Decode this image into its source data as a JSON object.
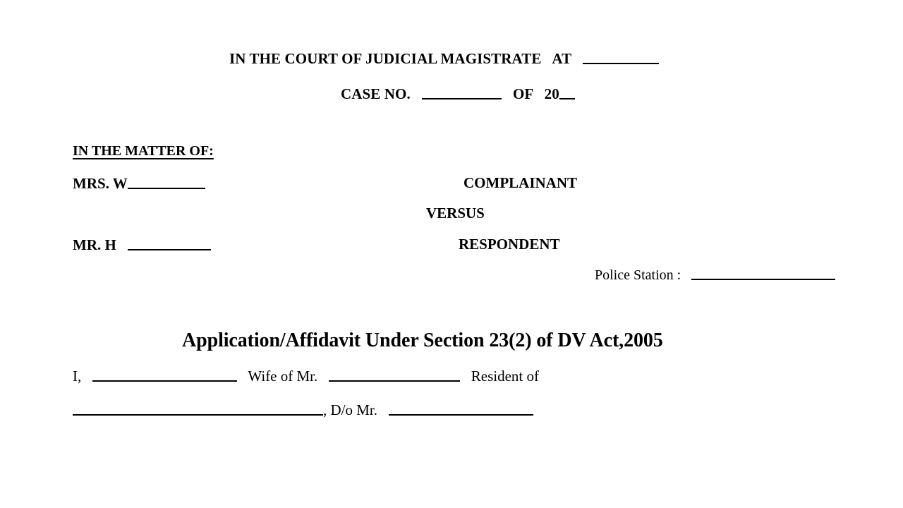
{
  "document": {
    "heading": {
      "court_line_prefix": "IN THE COURT OF JUDICIAL MAGISTRATE",
      "court_line_at": "AT",
      "case_no_label": "CASE NO.",
      "case_no_of": "OF",
      "case_year_prefix": "20"
    },
    "matter": {
      "matter_of_label": "IN THE MATTER OF:",
      "complainant_name": "MRS. W",
      "complainant_label": "COMPLAINANT",
      "versus_label": "VERSUS",
      "respondent_name": "MR. H",
      "respondent_label": "RESPONDENT",
      "police_station_label": "Police Station :"
    },
    "title": "Application/Affidavit Under Section 23(2) of DV Act,2005",
    "body": {
      "line1_i": "I,",
      "line1_wife_of": "Wife of Mr.",
      "line1_resident_of": "Resident of",
      "line2_daughter_of": ", D/o Mr."
    }
  },
  "colors": {
    "page_background": "#ffffff",
    "text": "#000000",
    "rule": "#000000"
  }
}
